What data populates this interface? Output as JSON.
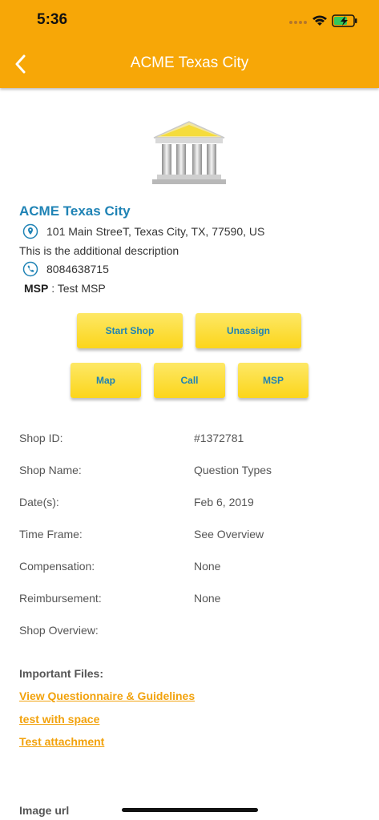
{
  "status_bar": {
    "time": "5:36"
  },
  "header": {
    "title": "ACME Texas City",
    "background_color": "#f7a707",
    "back_icon": "chevron-left-icon"
  },
  "location": {
    "name": "ACME Texas City",
    "address": "101 Main StreeT, Texas City, TX, 77590, US",
    "description": "This is the additional description",
    "phone": "8084638715",
    "msp_label": "MSP",
    "msp_value": " : Test MSP"
  },
  "actions": {
    "start_shop": "Start Shop",
    "unassign": "Unassign",
    "map": "Map",
    "call": "Call",
    "msp": "MSP"
  },
  "details": [
    {
      "label": "Shop ID:",
      "value": "#1372781"
    },
    {
      "label": "Shop Name:",
      "value": "Question Types"
    },
    {
      "label": "Date(s):",
      "value": "Feb 6, 2019"
    },
    {
      "label": "Time Frame:",
      "value": "See Overview"
    },
    {
      "label": "Compensation:",
      "value": "None"
    },
    {
      "label": "Reimbursement:",
      "value": "None"
    },
    {
      "label": "Shop Overview:",
      "value": ""
    }
  ],
  "files": {
    "heading": "Important Files:",
    "links": [
      "View Questionnaire & Guidelines",
      "test with space",
      "Test attachment"
    ]
  },
  "image_url_label": "Image url",
  "colors": {
    "accent": "#f7a707",
    "link_blue": "#1f83b5",
    "button_yellow": "#fcd51a",
    "file_link": "#f2a20c"
  }
}
